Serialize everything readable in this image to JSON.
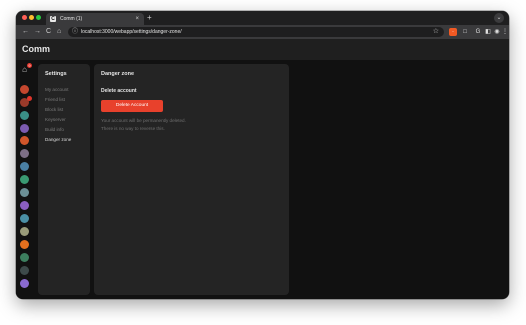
{
  "browser": {
    "tab_title": "Comm (1)",
    "tab_favicon_letter": "C",
    "tab_close": "×",
    "new_tab": "+",
    "tab_menu": "⌄",
    "back": "←",
    "forward": "→",
    "reload": "C",
    "home": "⌂",
    "url": "localhost:3000/webapp/settings/danger-zone/",
    "extensions": [
      {
        "name": "ext-orange-icon",
        "glyph": "·"
      },
      {
        "name": "ext-square-icon",
        "glyph": "□"
      },
      {
        "name": "ext-g-icon",
        "glyph": "G"
      },
      {
        "name": "sidebar-icon",
        "glyph": "◧"
      },
      {
        "name": "profile-icon",
        "glyph": "◉"
      },
      {
        "name": "menu-icon",
        "glyph": "⋮"
      }
    ]
  },
  "app": {
    "brand": "Comm",
    "home_badge": "9",
    "settings": {
      "title": "Settings",
      "items": [
        "My account",
        "Friend list",
        "Block list",
        "Keyserver",
        "Build info",
        "Danger zone"
      ],
      "active_index": 5
    },
    "danger_zone": {
      "title": "Danger zone",
      "section_title": "Delete account",
      "delete_button": "Delete Account",
      "warning_line1": "Your account will be permanently deleted.",
      "warning_line2": "There is no way to reverse this."
    },
    "colors": {
      "accent_red": "#e8412c",
      "background": "#111111",
      "panel": "#242424"
    }
  }
}
